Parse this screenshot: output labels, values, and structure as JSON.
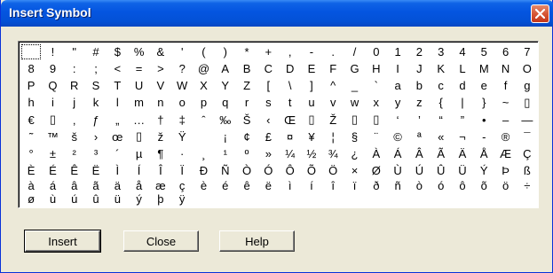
{
  "window": {
    "title": "Insert Symbol"
  },
  "buttons": {
    "insert": "Insert",
    "close": "Close",
    "help": "Help"
  },
  "symbols": [
    [
      "",
      "!",
      "\"",
      "#",
      "$",
      "%",
      "&",
      "'",
      "(",
      ")",
      "*",
      "+",
      ",",
      "-",
      ".",
      "/",
      "0",
      "1",
      "2",
      "3",
      "4",
      "5",
      "6",
      "7"
    ],
    [
      "8",
      "9",
      ":",
      ";",
      "<",
      "=",
      ">",
      "?",
      "@",
      "A",
      "B",
      "C",
      "D",
      "E",
      "F",
      "G",
      "H",
      "I",
      "J",
      "K",
      "L",
      "M",
      "N",
      "O"
    ],
    [
      "P",
      "Q",
      "R",
      "S",
      "T",
      "U",
      "V",
      "W",
      "X",
      "Y",
      "Z",
      "[",
      "\\",
      "]",
      "^",
      "_",
      "`",
      "a",
      "b",
      "c",
      "d",
      "e",
      "f",
      "g"
    ],
    [
      "h",
      "i",
      "j",
      "k",
      "l",
      "m",
      "n",
      "o",
      "p",
      "q",
      "r",
      "s",
      "t",
      "u",
      "v",
      "w",
      "x",
      "y",
      "z",
      "{",
      "|",
      "}",
      "~",
      "▯"
    ],
    [
      "€",
      "▯",
      "‚",
      "ƒ",
      "„",
      "…",
      "†",
      "‡",
      "ˆ",
      "‰",
      "Š",
      "‹",
      "Œ",
      "▯",
      "Ž",
      "▯",
      "▯",
      "‘",
      "’",
      "“",
      "”",
      "•",
      "–",
      "—"
    ],
    [
      "˜",
      "™",
      "š",
      "›",
      "œ",
      "▯",
      "ž",
      "Ÿ",
      "",
      "¡",
      "¢",
      "£",
      "¤",
      "¥",
      "¦",
      "§",
      "¨",
      "©",
      "ª",
      "«",
      "¬",
      "-",
      "®",
      "¯"
    ],
    [
      "°",
      "±",
      "²",
      "³",
      "´",
      "µ",
      "¶",
      "·",
      "¸",
      "¹",
      "º",
      "»",
      "¼",
      "½",
      "¾",
      "¿",
      "À",
      "Á",
      "Â",
      "Ã",
      "Ä",
      "Å",
      "Æ",
      "Ç"
    ],
    [
      "È",
      "É",
      "Ê",
      "Ë",
      "Ì",
      "Í",
      "Î",
      "Ï",
      "Ð",
      "Ñ",
      "Ò",
      "Ó",
      "Ô",
      "Õ",
      "Ö",
      "×",
      "Ø",
      "Ù",
      "Ú",
      "Û",
      "Ü",
      "Ý",
      "Þ",
      "ß"
    ],
    [
      "à",
      "á",
      "â",
      "ã",
      "ä",
      "å",
      "æ",
      "ç",
      "è",
      "é",
      "ê",
      "ë",
      "ì",
      "í",
      "î",
      "ï",
      "ð",
      "ñ",
      "ò",
      "ó",
      "ô",
      "õ",
      "ö",
      "÷"
    ],
    [
      "ø",
      "ù",
      "ú",
      "û",
      "ü",
      "ý",
      "þ",
      "ÿ"
    ]
  ],
  "colors": {
    "titlebar": "#0455e0",
    "close_button": "#d55332",
    "dialog_bg": "#ece9d8"
  }
}
